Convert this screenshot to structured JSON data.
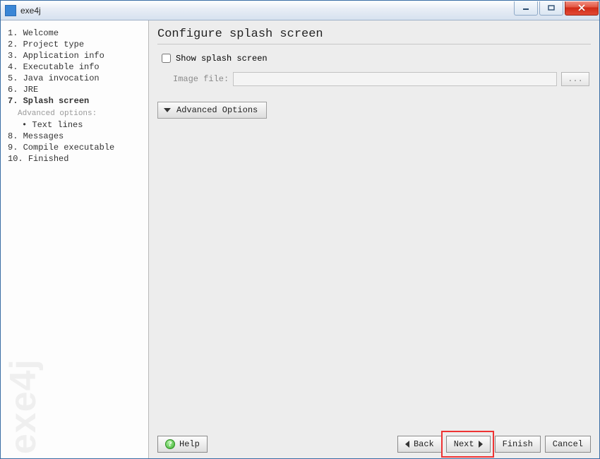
{
  "window": {
    "title": "exe4j"
  },
  "sidebar": {
    "brand": "exe4j",
    "steps": [
      {
        "n": "1.",
        "label": "Welcome"
      },
      {
        "n": "2.",
        "label": "Project type"
      },
      {
        "n": "3.",
        "label": "Application info"
      },
      {
        "n": "4.",
        "label": "Executable info"
      },
      {
        "n": "5.",
        "label": "Java invocation"
      },
      {
        "n": "6.",
        "label": "JRE"
      },
      {
        "n": "7.",
        "label": "Splash screen",
        "current": true
      },
      {
        "n": "8.",
        "label": "Messages"
      },
      {
        "n": "9.",
        "label": "Compile executable"
      },
      {
        "n": "10.",
        "label": "Finished"
      }
    ],
    "sub_header": "Advanced options:",
    "sub_item": "Text lines"
  },
  "main": {
    "title": "Configure splash screen",
    "show_splash_label": "Show splash screen",
    "show_splash_checked": false,
    "image_file_label": "Image file:",
    "image_file_value": "",
    "browse_label": "...",
    "advanced_label": "Advanced Options"
  },
  "footer": {
    "help": "Help",
    "back": "Back",
    "next": "Next",
    "finish": "Finish",
    "cancel": "Cancel"
  }
}
